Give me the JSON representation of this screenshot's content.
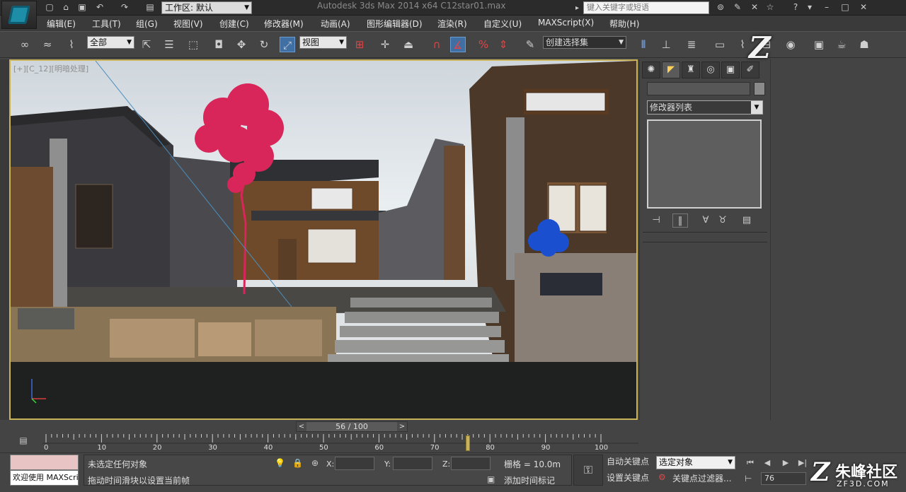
{
  "titlebar": {
    "workspace": "工作区: 默认",
    "app_title": "Autodesk 3ds Max  2014 x64      C12star01.max",
    "search_placeholder": "键入关键字或短语"
  },
  "menu": [
    "编辑(E)",
    "工具(T)",
    "组(G)",
    "视图(V)",
    "创建(C)",
    "修改器(M)",
    "动画(A)",
    "图形编辑器(D)",
    "渲染(R)",
    "自定义(U)",
    "MAXScript(X)",
    "帮助(H)"
  ],
  "toolbar": {
    "filter_value": "全部",
    "refcoord_value": "视图",
    "selection_set_value": "创建选择集"
  },
  "viewport": {
    "label": "[+][C_12][明暗处理]"
  },
  "command_panel": {
    "modifier_list": "修改器列表"
  },
  "timeline": {
    "slider": "56 / 100",
    "ticks": [
      "0",
      "10",
      "20",
      "30",
      "40",
      "50",
      "60",
      "70",
      "80",
      "90",
      "100"
    ]
  },
  "status": {
    "maxscript_label": "欢迎使用 MAXScri",
    "selection_msg": "未选定任何对象",
    "prompt_msg": "拖动时间滑块以设置当前帧",
    "x_label": "X:",
    "y_label": "Y:",
    "z_label": "Z:",
    "grid": "栅格 = 10.0m",
    "add_time_tag": "添加时间标记",
    "auto_key": "自动关键点",
    "set_key": "设置关键点",
    "selected_dd": "选定对象",
    "key_filters": "关键点过滤器...",
    "frame": "76"
  },
  "watermark": {
    "top": "Z",
    "cn": "朱峰社区",
    "en": "ZF3D.COM",
    "z": "Z"
  },
  "colors": {
    "viewport_border": "#c8b25a",
    "tree_pink": "#d8265a",
    "bush_blue": "#1a4fd0"
  }
}
